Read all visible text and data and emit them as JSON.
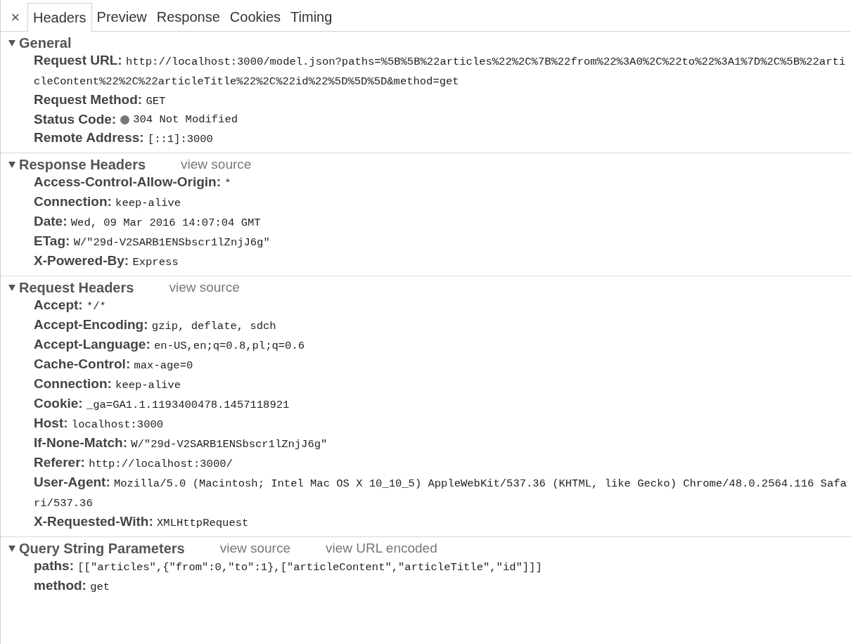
{
  "close_label": "×",
  "tabs": [
    {
      "label": "Headers",
      "selected": true
    },
    {
      "label": "Preview",
      "selected": false
    },
    {
      "label": "Response",
      "selected": false
    },
    {
      "label": "Cookies",
      "selected": false
    },
    {
      "label": "Timing",
      "selected": false
    }
  ],
  "sections": [
    {
      "title": "General",
      "expanded": true,
      "rows": [
        {
          "name": "Request URL:",
          "value": "http://localhost:3000/model.json?paths=%5B%5B%22articles%22%2C%7B%22from%22%3A0%2C%22to%22%3A1%7D%2C%5B%22articleContent%22%2C%22articleTitle%22%2C%22id%22%5D%5D%5D&method=get"
        },
        {
          "name": "Request Method:",
          "value": "GET"
        },
        {
          "name": "Status Code:",
          "value": "304 Not Modified",
          "status_dot": true
        },
        {
          "name": "Remote Address:",
          "value": "[::1]:3000"
        }
      ]
    },
    {
      "title": "Response Headers",
      "expanded": true,
      "links": [
        "view source"
      ],
      "rows": [
        {
          "name": "Access-Control-Allow-Origin:",
          "value": "*"
        },
        {
          "name": "Connection:",
          "value": "keep-alive"
        },
        {
          "name": "Date:",
          "value": "Wed, 09 Mar 2016 14:07:04 GMT"
        },
        {
          "name": "ETag:",
          "value": "W/\"29d-V2SARB1ENSbscr1lZnjJ6g\""
        },
        {
          "name": "X-Powered-By:",
          "value": "Express"
        }
      ]
    },
    {
      "title": "Request Headers",
      "expanded": true,
      "links": [
        "view source"
      ],
      "rows": [
        {
          "name": "Accept:",
          "value": "*/*"
        },
        {
          "name": "Accept-Encoding:",
          "value": "gzip, deflate, sdch"
        },
        {
          "name": "Accept-Language:",
          "value": "en-US,en;q=0.8,pl;q=0.6"
        },
        {
          "name": "Cache-Control:",
          "value": "max-age=0"
        },
        {
          "name": "Connection:",
          "value": "keep-alive"
        },
        {
          "name": "Cookie:",
          "value": "_ga=GA1.1.1193400478.1457118921"
        },
        {
          "name": "Host:",
          "value": "localhost:3000"
        },
        {
          "name": "If-None-Match:",
          "value": "W/\"29d-V2SARB1ENSbscr1lZnjJ6g\""
        },
        {
          "name": "Referer:",
          "value": "http://localhost:3000/"
        },
        {
          "name": "User-Agent:",
          "value": "Mozilla/5.0 (Macintosh; Intel Mac OS X 10_10_5) AppleWebKit/537.36 (KHTML, like Gecko) Chrome/48.0.2564.116 Safari/537.36"
        },
        {
          "name": "X-Requested-With:",
          "value": "XMLHttpRequest"
        }
      ]
    },
    {
      "title": "Query String Parameters",
      "expanded": true,
      "links": [
        "view source",
        "view URL encoded"
      ],
      "rows": [
        {
          "name": "paths:",
          "value": "[[\"articles\",{\"from\":0,\"to\":1},[\"articleContent\",\"articleTitle\",\"id\"]]]"
        },
        {
          "name": "method:",
          "value": "get"
        }
      ]
    }
  ]
}
